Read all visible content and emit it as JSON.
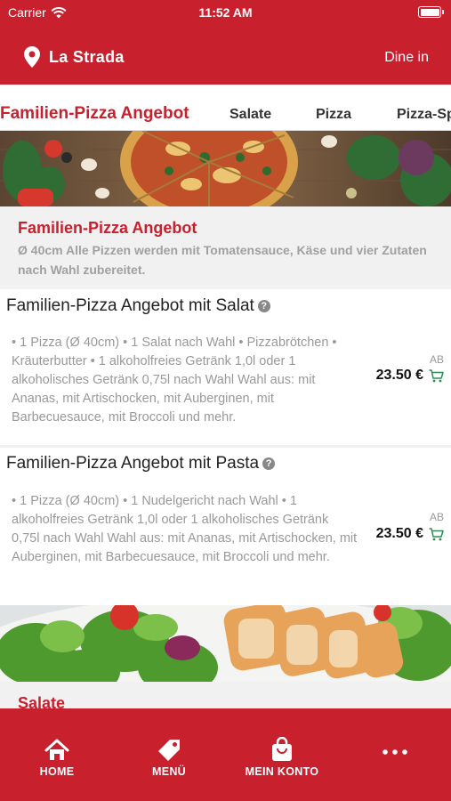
{
  "status_bar": {
    "carrier": "Carrier",
    "time": "11:52 AM"
  },
  "header": {
    "store_name": "La Strada",
    "mode": "Dine in"
  },
  "tabs": [
    {
      "label": "Familien-Pizza Angebot",
      "active": true
    },
    {
      "label": "Salate"
    },
    {
      "label": "Pizza"
    },
    {
      "label": "Pizza-Sp"
    }
  ],
  "category": {
    "title": "Familien-Pizza Angebot",
    "description": "Ø 40cm Alle Pizzen werden mit Tomatensauce, Käse und vier Zutaten nach Wahl zubereitet."
  },
  "items": [
    {
      "title": "Familien-Pizza Angebot mit Salat",
      "description": "• 1 Pizza (Ø 40cm) • 1 Salat nach Wahl • Pizzabrötchen • Kräuterbutter • 1 alkoholfreies Getränk 1,0l oder 1 alkoholisches Getränk 0,75l nach Wahl Wahl aus: mit Ananas, mit Artischocken, mit Auberginen, mit Barbecuesauce, mit Broccoli und mehr.",
      "price_prefix": "AB",
      "price": "23.50 €"
    },
    {
      "title": "Familien-Pizza Angebot mit Pasta",
      "description": "• 1 Pizza (Ø 40cm) • 1 Nudelgericht nach Wahl • 1 alkoholfreies Getränk 1,0l oder 1 alkoholisches Getränk 0,75l nach Wahl Wahl aus: mit Ananas, mit Artischocken, mit Auberginen, mit Barbecuesauce, mit Broccoli und mehr.",
      "price_prefix": "AB",
      "price": "23.50 €"
    }
  ],
  "next_category": {
    "title": "Salate"
  },
  "bottom_nav": [
    {
      "label": "HOME",
      "icon": "home-icon"
    },
    {
      "label": "MENÜ",
      "icon": "tag-icon"
    },
    {
      "label": "MEIN KONTO",
      "icon": "shopping-bag-icon"
    },
    {
      "label": "",
      "icon": "more-dots-icon"
    }
  ],
  "colors": {
    "brand": "#c8202d",
    "cart": "#2e8b57"
  }
}
